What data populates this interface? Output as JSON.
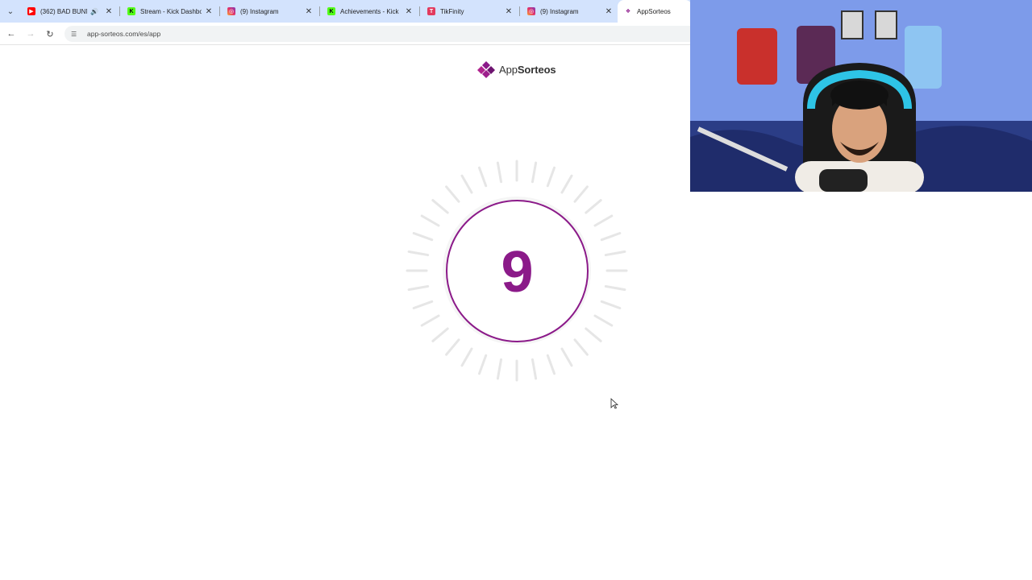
{
  "browser": {
    "tabs": [
      {
        "title": "(362) BAD BUNNY",
        "favicon": "youtube-icon",
        "audio": true
      },
      {
        "title": "Stream - Kick Dashboard",
        "favicon": "kick-icon"
      },
      {
        "title": "(9) Instagram",
        "favicon": "instagram-icon"
      },
      {
        "title": "Achievements - Kick",
        "favicon": "kick-icon"
      },
      {
        "title": "TikFinity",
        "favicon": "tikfinity-icon"
      },
      {
        "title": "(9) Instagram",
        "favicon": "instagram-icon"
      },
      {
        "title": "AppSorteos",
        "favicon": "appsorteos-icon",
        "active": true
      }
    ],
    "url": "app-sorteos.com/es/app"
  },
  "page": {
    "logo": {
      "prefix": "App",
      "bold": "Sorteos"
    },
    "countdown": "9"
  },
  "colors": {
    "brand": "#8b1a89",
    "tabbar": "#d3e3fd"
  },
  "webcam": {
    "label": "streamer-webcam-overlay"
  }
}
